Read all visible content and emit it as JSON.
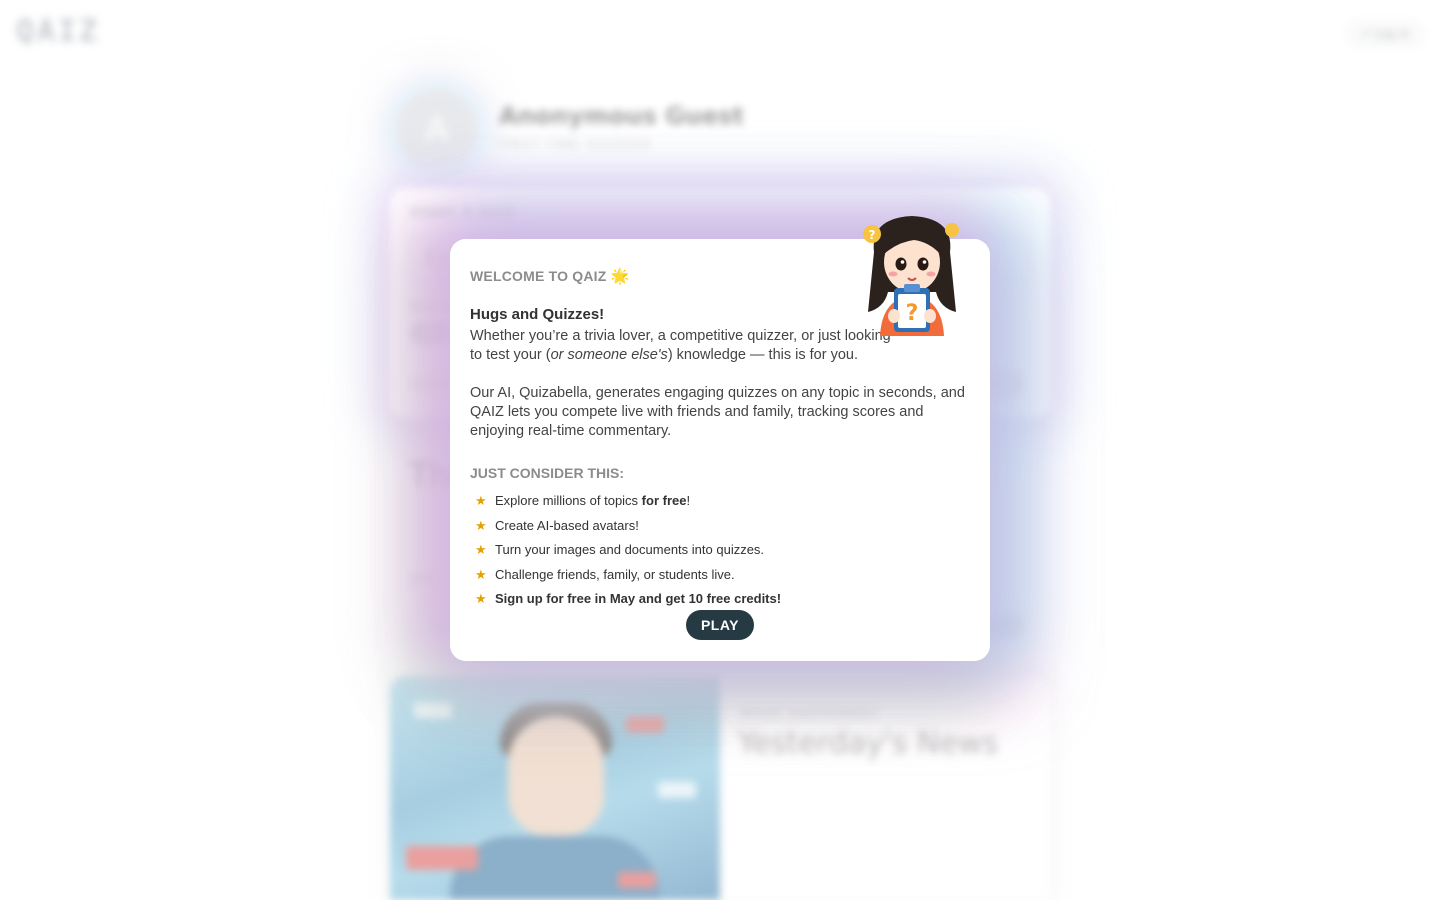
{
  "header": {
    "logo": "QAIZ",
    "login_label": "Log in"
  },
  "profile": {
    "avatar_letter": "A",
    "name": "Anonymous Guest",
    "subtitle": "FIRST TIME QUIZZER"
  },
  "start_quiz": {
    "label": "START A QUIZ",
    "input_placeholder": "En",
    "difficulty_label": "Realistic",
    "difficulty_chip": "SEL",
    "create_label": "CREATE",
    "create_button": "Go"
  },
  "section2": {
    "title": "The",
    "join_label": "JOIN",
    "code_placeholder": "Qui",
    "code_button": "Join"
  },
  "news": {
    "label": "WHAT HAPPENED?",
    "title": "Yesterday's News"
  },
  "modal": {
    "title": "WELCOME TO QAIZ",
    "title_emoji": "🌟",
    "heading": "Hugs and Quizzes!",
    "para1_pre": "Whether you’re a trivia lover, a competitive quizzer, or just looking to test your (",
    "para1_em": "or someone else's",
    "para1_post": ") knowledge — this is for you.",
    "para2": "Our AI, Quizabella, generates engaging quizzes on any topic in seconds, and QAIZ lets you compete live with friends and family, tracking scores and enjoying real-time commentary.",
    "consider_title": "JUST CONSIDER THIS:",
    "benefit1_pre": "Explore millions of topics ",
    "benefit1_bold": "for free",
    "benefit1_post": "!",
    "benefit2": "Create AI-based avatars!",
    "benefit3": "Turn your images and documents into quizzes.",
    "benefit4": "Challenge friends, family, or students live.",
    "benefit5": "Sign up for free in May and get 10 free credits!",
    "play_label": "PLAY",
    "star_glyph": "★"
  },
  "colors": {
    "play_button": "#263a44",
    "star": "#e5a100",
    "muted_heading": "#8c8c8c"
  }
}
